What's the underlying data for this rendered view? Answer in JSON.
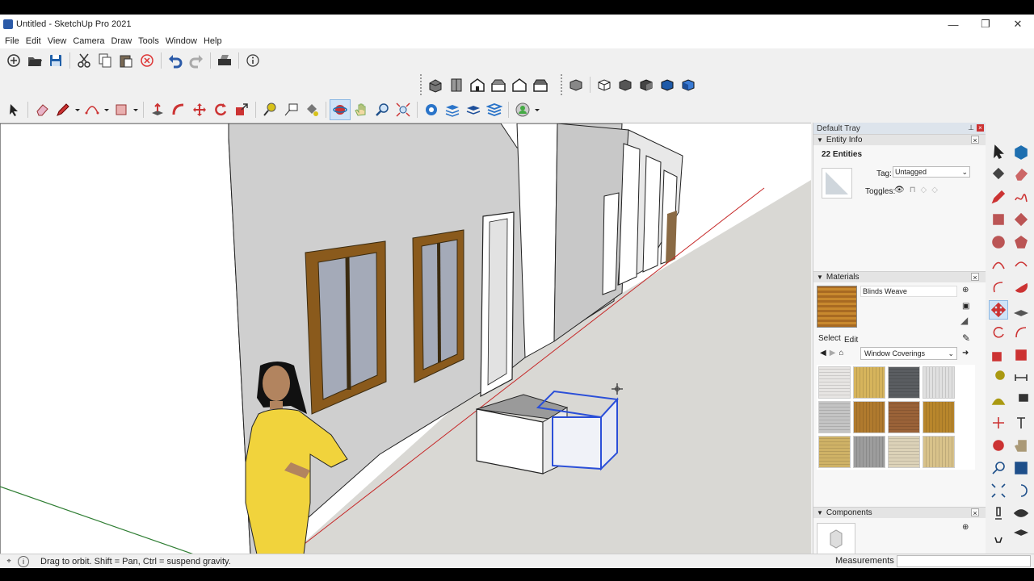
{
  "window": {
    "title": "Untitled - SketchUp Pro 2021",
    "minimize": "—",
    "restore": "❐",
    "close": "✕"
  },
  "menu": [
    "File",
    "Edit",
    "View",
    "Camera",
    "Draw",
    "Tools",
    "Window",
    "Help"
  ],
  "tray": {
    "title": "Default Tray",
    "entity_info": {
      "header": "Entity Info",
      "count": "22 Entities",
      "tag_label": "Tag:",
      "tag_value": "Untagged",
      "toggles_label": "Toggles:"
    },
    "materials": {
      "header": "Materials",
      "current_name": "Blinds Weave",
      "tabs": [
        "Select",
        "Edit"
      ],
      "collection": "Window Coverings",
      "swatch_colors": [
        "#e7e5e3",
        "#d6b45c",
        "#5a5d61",
        "#e0e0e0",
        "#c4c4c4",
        "#b07a2e",
        "#9a6238",
        "#b8862c",
        "#cfb266",
        "#9d9d9d",
        "#dcd2b8",
        "#d8c28a"
      ]
    },
    "components": {
      "header": "Components"
    }
  },
  "status": {
    "message": "Drag to orbit.  Shift = Pan, Ctrl = suspend gravity.",
    "measurements_label": "Measurements",
    "measurements_value": ""
  },
  "colors": {
    "accent_blue": "#2b4fd8",
    "red_axis": "#c62828",
    "green_axis": "#2e7d32",
    "wall": "#cfcfcf",
    "ground": "#d9d8d4"
  }
}
